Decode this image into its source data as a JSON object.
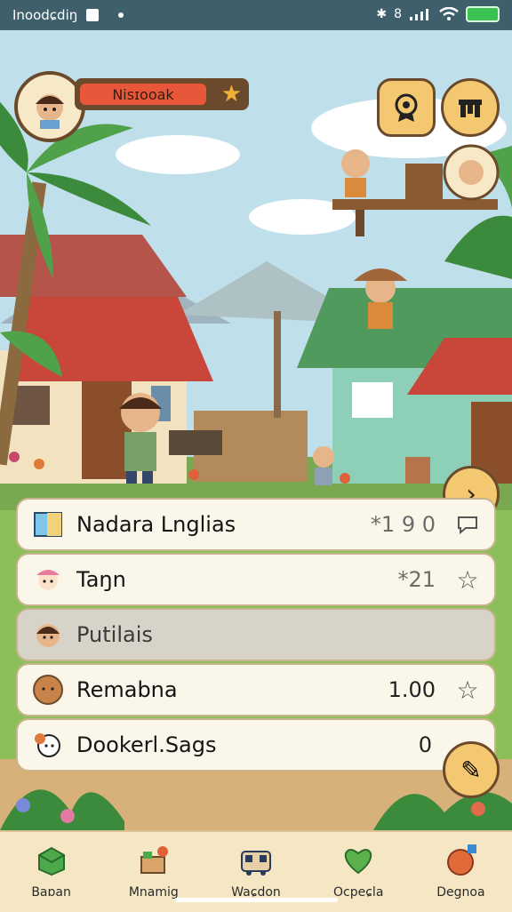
{
  "status_bar": {
    "app_name": "Inoodɕdiŋ",
    "time": "8",
    "bt": "✱"
  },
  "player": {
    "name": "Nisɪooak"
  },
  "list": [
    {
      "label": "Nadara Lnglias",
      "value": "*1 9 0",
      "icon": "book-icon",
      "action": "chat-icon"
    },
    {
      "label": "Taŋn",
      "value": "*21",
      "icon": "character-icon",
      "action": "star-icon"
    },
    {
      "label": "Putilais",
      "value": "",
      "icon": "character-icon",
      "action": ""
    },
    {
      "label": "Remabna",
      "value": "1.00",
      "icon": "coin-icon",
      "action": "star-icon"
    },
    {
      "label": "Dookerl.Sags",
      "value": "0",
      "icon": "character-icon",
      "action": ""
    }
  ],
  "nav": [
    {
      "label": "Baɒan",
      "icon": "box-icon"
    },
    {
      "label": "Mnamig",
      "icon": "basket-icon"
    },
    {
      "label": "Waɕdon",
      "icon": "bus-icon"
    },
    {
      "label": "Ocpeɕla",
      "icon": "heart-icon"
    },
    {
      "label": "Degnoa",
      "icon": "orb-icon"
    }
  ],
  "colors": {
    "accent": "#f4c870",
    "frame": "#6b4a2c",
    "banner": "#e9573a",
    "status_bg": "#3f5f6a"
  }
}
